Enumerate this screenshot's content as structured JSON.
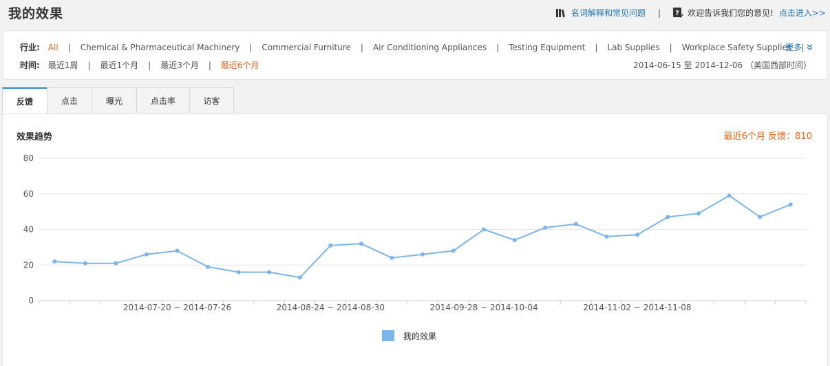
{
  "header": {
    "title": "我的效果",
    "glossary_link": "名词解释和常见问题",
    "separator": "|",
    "feedback_prompt": "欢迎告诉我们您的意见!",
    "feedback_link": "点击进入>>"
  },
  "filters": {
    "industry_label": "行业:",
    "industries": [
      {
        "label": "All",
        "active": true
      },
      {
        "label": "Chemical & Pharmaceutical Machinery",
        "active": false
      },
      {
        "label": "Commercial Furniture",
        "active": false
      },
      {
        "label": "Air Conditioning Appliances",
        "active": false
      },
      {
        "label": "Testing Equipment",
        "active": false
      },
      {
        "label": "Lab Supplies",
        "active": false
      },
      {
        "label": "Workplace Safety Supplies",
        "active": false
      }
    ],
    "more_label": "更多",
    "time_label": "时间:",
    "times": [
      {
        "label": "最近1周",
        "active": false
      },
      {
        "label": "最近1个月",
        "active": false
      },
      {
        "label": "最近3个月",
        "active": false
      },
      {
        "label": "最近6个月",
        "active": true
      }
    ],
    "date_range": "2014-06-15 至 2014-12-06 （美国西部时间）"
  },
  "tabs": [
    {
      "label": "反馈",
      "active": true
    },
    {
      "label": "点击",
      "active": false
    },
    {
      "label": "曝光",
      "active": false
    },
    {
      "label": "点击率",
      "active": false
    },
    {
      "label": "访客",
      "active": false
    }
  ],
  "chart_panel": {
    "title": "效果趋势",
    "summary": "最近6个月  反馈：810"
  },
  "colors": {
    "accent_orange": "#e8641b",
    "link_blue": "#1e73be",
    "series_blue": "#7cb5ec",
    "tab_active_top": "#2a88c8"
  },
  "chart_data": {
    "type": "line",
    "x": [
      "",
      "",
      "",
      "",
      "2014-07-20 ~ 2014-07-26",
      "",
      "",
      "",
      "",
      "2014-08-24 ~ 2014-08-30",
      "",
      "",
      "",
      "",
      "2014-09-28 ~ 2014-10-04",
      "",
      "",
      "",
      "",
      "2014-11-02 ~ 2014-11-08",
      "",
      "",
      "",
      "",
      ""
    ],
    "series": [
      {
        "name": "我的效果",
        "values": [
          22,
          21,
          21,
          26,
          28,
          19,
          16,
          16,
          13,
          31,
          32,
          24,
          26,
          28,
          40,
          34,
          41,
          43,
          36,
          37,
          47,
          49,
          59,
          47,
          54
        ]
      }
    ],
    "yticks": [
      0,
      20,
      40,
      60,
      80
    ],
    "ylim": [
      0,
      80
    ],
    "grid": true,
    "legend": "bottom-center"
  }
}
